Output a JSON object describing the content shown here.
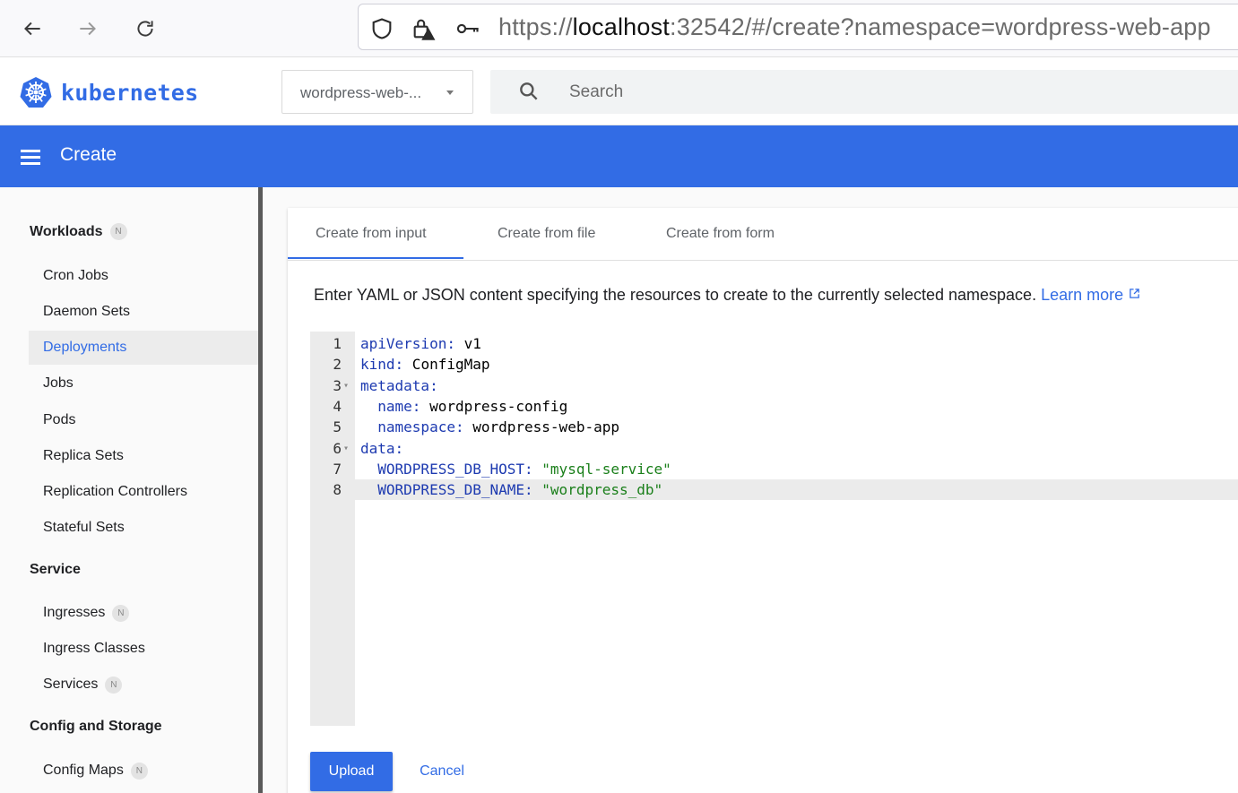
{
  "browser": {
    "url_prefix": "https://",
    "url_host": "localhost",
    "url_rest": ":32542/#/create?namespace=wordpress-web-app",
    "icons": [
      "back-arrow-icon",
      "forward-arrow-icon",
      "reload-icon",
      "shield-icon",
      "lock-warning-icon",
      "key-icon"
    ]
  },
  "header": {
    "brand": "kubernetes",
    "namespace": "wordpress-web-...",
    "search_placeholder": "Search"
  },
  "toolbar": {
    "title": "Create"
  },
  "sidebar": {
    "sections": [
      {
        "label": "Workloads",
        "badge": "N"
      },
      {
        "label": "Service"
      },
      {
        "label": "Config and Storage"
      }
    ],
    "items": [
      {
        "label": "Cron Jobs"
      },
      {
        "label": "Daemon Sets"
      },
      {
        "label": "Deployments",
        "active": true
      },
      {
        "label": "Jobs"
      },
      {
        "label": "Pods"
      },
      {
        "label": "Replica Sets"
      },
      {
        "label": "Replication Controllers"
      },
      {
        "label": "Stateful Sets"
      },
      {
        "label": "Ingresses",
        "badge": "N"
      },
      {
        "label": "Ingress Classes"
      },
      {
        "label": "Services",
        "badge": "N"
      },
      {
        "label": "Config Maps",
        "badge": "N"
      }
    ]
  },
  "tabs": [
    {
      "label": "Create from input",
      "active": true
    },
    {
      "label": "Create from file"
    },
    {
      "label": "Create from form"
    }
  ],
  "description": {
    "text": "Enter YAML or JSON content specifying the resources to create to the currently selected namespace.",
    "link": "Learn more"
  },
  "editor": {
    "lines": [
      {
        "n": "1",
        "key": "apiVersion:",
        "val": " v1"
      },
      {
        "n": "2",
        "key": "kind:",
        "val": " ConfigMap"
      },
      {
        "n": "3",
        "key": "metadata:",
        "val": "",
        "fold": true
      },
      {
        "n": "4",
        "key": "  name:",
        "val": " wordpress-config"
      },
      {
        "n": "5",
        "key": "  namespace:",
        "val": " wordpress-web-app"
      },
      {
        "n": "6",
        "key": "data:",
        "val": "",
        "fold": true
      },
      {
        "n": "7",
        "key": "  WORDPRESS_DB_HOST:",
        "str": " \"mysql-service\""
      },
      {
        "n": "8",
        "key": "  WORDPRESS_DB_NAME:",
        "str": " \"wordpress_db\"",
        "highlight": true
      }
    ]
  },
  "actions": {
    "upload": "Upload",
    "cancel": "Cancel"
  },
  "colors": {
    "primary": "#326ce5",
    "string": "#1a7f1a",
    "key": "#0c3c94"
  }
}
